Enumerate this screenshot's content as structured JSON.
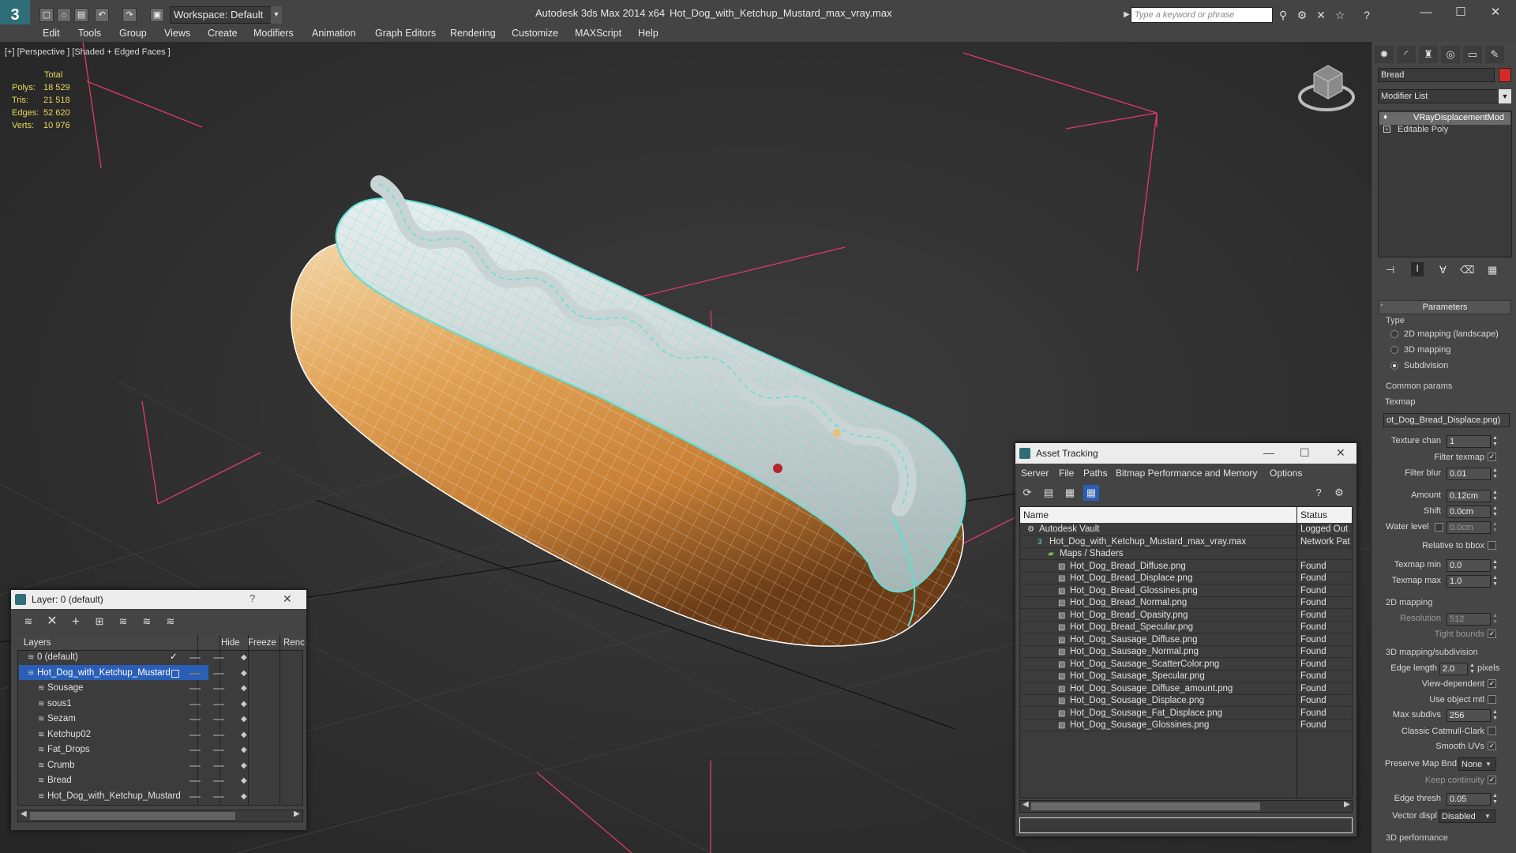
{
  "titlebar": {
    "workspace_label": "Workspace: Default",
    "app_name": "Autodesk 3ds Max  2014 x64",
    "file_name": "Hot_Dog_with_Ketchup_Mustard_max_vray.max",
    "search_placeholder": "Type a keyword or phrase",
    "logo_text": "3"
  },
  "menu": [
    "Edit",
    "Tools",
    "Group",
    "Views",
    "Create",
    "Modifiers",
    "Animation",
    "Graph Editors",
    "Rendering",
    "Customize",
    "MAXScript",
    "Help"
  ],
  "viewport": {
    "label": "[+] [Perspective ] [Shaded + Edged Faces ]",
    "stats_header": "Total",
    "stats": [
      {
        "label": "Polys:",
        "value": "18 529"
      },
      {
        "label": "Tris:",
        "value": "21 518"
      },
      {
        "label": "Edges:",
        "value": "52 620"
      },
      {
        "label": "Verts:",
        "value": "10 976"
      }
    ]
  },
  "command_panel": {
    "object_name": "Bread",
    "object_color": "#d42a2a",
    "modifier_list_label": "Modifier List",
    "stack": [
      "VRayDisplacementMod",
      "Editable Poly"
    ],
    "rollout_title": "Parameters",
    "type_label": "Type",
    "type_options": [
      {
        "label": "2D mapping (landscape)",
        "selected": false
      },
      {
        "label": "3D mapping",
        "selected": false
      },
      {
        "label": "Subdivision",
        "selected": true
      }
    ],
    "common_params_label": "Common params",
    "texmap_label": "Texmap",
    "texmap_value": "ot_Dog_Bread_Displace.png)",
    "texture_chan": {
      "label": "Texture chan",
      "value": "1"
    },
    "filter_texmap": {
      "label": "Filter texmap",
      "checked": true
    },
    "filter_blur": {
      "label": "Filter blur",
      "value": "0.01"
    },
    "amount": {
      "label": "Amount",
      "value": "0.12cm"
    },
    "shift": {
      "label": "Shift",
      "value": "0.0cm"
    },
    "water_level": {
      "label": "Water level",
      "value": "0.0cm",
      "checked": false
    },
    "relative_to_bbox": {
      "label": "Relative to bbox",
      "checked": false
    },
    "texmap_min": {
      "label": "Texmap min",
      "value": "0.0"
    },
    "texmap_max": {
      "label": "Texmap max",
      "value": "1.0"
    },
    "mapping2d_label": "2D mapping",
    "resolution": {
      "label": "Resolution",
      "value": "512"
    },
    "tight_bounds": {
      "label": "Tight bounds",
      "checked": true
    },
    "mapping3d_label": "3D mapping/subdivision",
    "edge_length": {
      "label": "Edge length",
      "value": "2.0",
      "unit": "pixels"
    },
    "view_dependent": {
      "label": "View-dependent",
      "checked": true
    },
    "use_object_mtl": {
      "label": "Use object mtl",
      "checked": false
    },
    "max_subdivs": {
      "label": "Max subdivs",
      "value": "256"
    },
    "classic_catmull": {
      "label": "Classic Catmull-Clark",
      "checked": false
    },
    "smooth_uvs": {
      "label": "Smooth UVs",
      "checked": true
    },
    "preserve_map_bnd": {
      "label": "Preserve Map Bnd",
      "value": "None"
    },
    "keep_continuity": {
      "label": "Keep continuity",
      "checked": true
    },
    "edge_thresh": {
      "label": "Edge thresh",
      "value": "0.05"
    },
    "vector_displ": {
      "label": "Vector displ",
      "value": "Disabled"
    },
    "performance_label": "3D performance"
  },
  "layer_window": {
    "title": "Layer: 0 (default)",
    "help": "?",
    "columns": [
      "Layers",
      "Hide",
      "Freeze",
      "Renc"
    ],
    "rows": [
      {
        "name": "0 (default)",
        "level": 0,
        "selected": false,
        "current": true
      },
      {
        "name": "Hot_Dog_with_Ketchup_Mustard",
        "level": 0,
        "selected": true,
        "current": false
      },
      {
        "name": "Sousage",
        "level": 1,
        "selected": false,
        "current": false
      },
      {
        "name": "sous1",
        "level": 1,
        "selected": false,
        "current": false
      },
      {
        "name": "Sezam",
        "level": 1,
        "selected": false,
        "current": false
      },
      {
        "name": "Ketchup02",
        "level": 1,
        "selected": false,
        "current": false
      },
      {
        "name": "Fat_Drops",
        "level": 1,
        "selected": false,
        "current": false
      },
      {
        "name": "Crumb",
        "level": 1,
        "selected": false,
        "current": false
      },
      {
        "name": "Bread",
        "level": 1,
        "selected": false,
        "current": false
      },
      {
        "name": "Hot_Dog_with_Ketchup_Mustard",
        "level": 1,
        "selected": false,
        "current": false
      }
    ]
  },
  "asset_window": {
    "title": "Asset Tracking",
    "menu": [
      "Server",
      "File",
      "Paths",
      "Bitmap Performance and Memory",
      "Options"
    ],
    "columns": [
      "Name",
      "Status"
    ],
    "rows": [
      {
        "name": "Autodesk Vault",
        "status": "Logged Out",
        "level": 0,
        "kind": "vault"
      },
      {
        "name": "Hot_Dog_with_Ketchup_Mustard_max_vray.max",
        "status": "Network Pat",
        "level": 1,
        "kind": "max"
      },
      {
        "name": "Maps / Shaders",
        "status": "",
        "level": 2,
        "kind": "folder"
      },
      {
        "name": "Hot_Dog_Bread_Diffuse.png",
        "status": "Found",
        "level": 3,
        "kind": "file"
      },
      {
        "name": "Hot_Dog_Bread_Displace.png",
        "status": "Found",
        "level": 3,
        "kind": "file"
      },
      {
        "name": "Hot_Dog_Bread_Glossines.png",
        "status": "Found",
        "level": 3,
        "kind": "file"
      },
      {
        "name": "Hot_Dog_Bread_Normal.png",
        "status": "Found",
        "level": 3,
        "kind": "file"
      },
      {
        "name": "Hot_Dog_Bread_Opasity.png",
        "status": "Found",
        "level": 3,
        "kind": "file"
      },
      {
        "name": "Hot_Dog_Bread_Specular.png",
        "status": "Found",
        "level": 3,
        "kind": "file"
      },
      {
        "name": "Hot_Dog_Sausage_Diffuse.png",
        "status": "Found",
        "level": 3,
        "kind": "file"
      },
      {
        "name": "Hot_Dog_Sausage_Normal.png",
        "status": "Found",
        "level": 3,
        "kind": "file"
      },
      {
        "name": "Hot_Dog_Sausage_ScatterColor.png",
        "status": "Found",
        "level": 3,
        "kind": "file"
      },
      {
        "name": "Hot_Dog_Sausage_Specular.png",
        "status": "Found",
        "level": 3,
        "kind": "file"
      },
      {
        "name": "Hot_Dog_Sousage_Diffuse_amount.png",
        "status": "Found",
        "level": 3,
        "kind": "file"
      },
      {
        "name": "Hot_Dog_Sousage_Displace.png",
        "status": "Found",
        "level": 3,
        "kind": "file"
      },
      {
        "name": "Hot_Dog_Sousage_Fat_Displace.png",
        "status": "Found",
        "level": 3,
        "kind": "file"
      },
      {
        "name": "Hot_Dog_Sousage_Glossines.png",
        "status": "Found",
        "level": 3,
        "kind": "file"
      }
    ]
  },
  "colors": {
    "accent": "#2f6e78",
    "selection": "#2a5fb8",
    "stats": "#e8d85a",
    "mesh_wire": "#5fe0d4",
    "bounding_box": "#e03a6a"
  }
}
